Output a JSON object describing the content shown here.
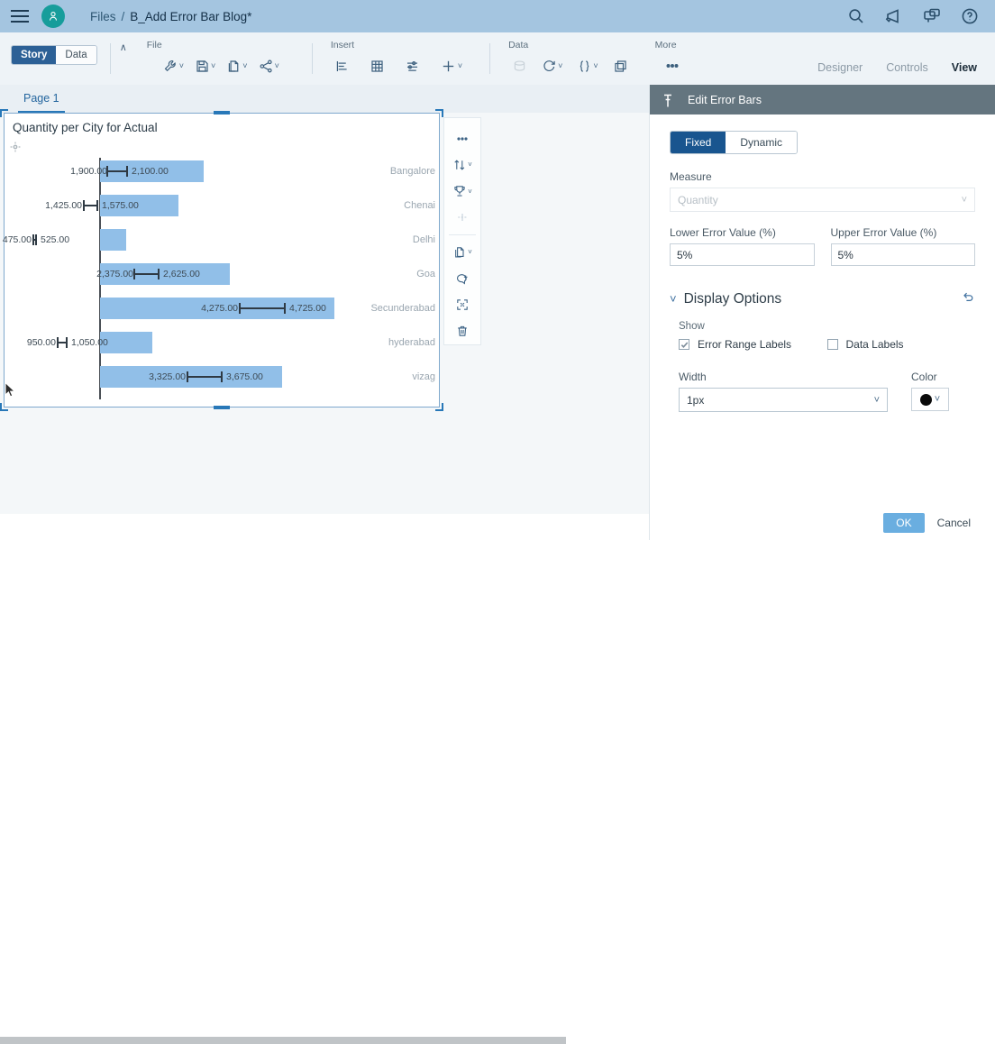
{
  "header": {
    "menu_icon": "hamburger-icon",
    "avatar_icon": "user-avatar-icon",
    "breadcrumb_root": "Files",
    "breadcrumb_sep": "/",
    "breadcrumb_current": "B_Add Error Bar Blog*",
    "actions": [
      {
        "name": "search-icon",
        "label": "Search"
      },
      {
        "name": "announcement-icon",
        "label": "Announcements"
      },
      {
        "name": "collaboration-icon",
        "label": "Collaboration"
      },
      {
        "name": "help-icon",
        "label": "Help"
      }
    ]
  },
  "ribbon": {
    "mode_story": "Story",
    "mode_data": "Data",
    "collapse_caret": "∧",
    "groups": [
      {
        "title": "File",
        "items": [
          {
            "name": "tools-icon",
            "caret": true,
            "disabled": false
          },
          {
            "name": "save-icon",
            "caret": true,
            "disabled": false
          },
          {
            "name": "copy-file-icon",
            "caret": true,
            "disabled": false
          },
          {
            "name": "share-icon",
            "caret": true,
            "disabled": false
          }
        ]
      },
      {
        "title": "Insert",
        "items": [
          {
            "name": "chart-icon",
            "caret": false,
            "disabled": false
          },
          {
            "name": "table-icon",
            "caret": false,
            "disabled": false
          },
          {
            "name": "filter-settings-icon",
            "caret": false,
            "disabled": false
          },
          {
            "name": "add-icon",
            "caret": true,
            "disabled": false
          }
        ]
      },
      {
        "title": "Data",
        "items": [
          {
            "name": "data-source-icon",
            "caret": false,
            "disabled": true
          },
          {
            "name": "refresh-icon",
            "caret": true,
            "disabled": false
          },
          {
            "name": "formula-icon",
            "caret": true,
            "disabled": false
          },
          {
            "name": "duplicate-icon",
            "caret": false,
            "disabled": false
          }
        ]
      },
      {
        "title": "More",
        "items": [
          {
            "name": "overflow-icon",
            "caret": false,
            "disabled": false
          }
        ]
      }
    ],
    "right_menu": [
      {
        "label": "Designer",
        "active": false
      },
      {
        "label": "Controls",
        "active": false
      },
      {
        "label": "View",
        "active": true
      }
    ]
  },
  "tabs": {
    "page_tab": "Page 1"
  },
  "widget_toolbar": [
    {
      "name": "more-options-icon",
      "caret": false,
      "disabled": false
    },
    {
      "name": "sort-icon",
      "caret": true,
      "disabled": false
    },
    {
      "name": "ranking-icon",
      "caret": true,
      "disabled": false
    },
    {
      "name": "reference-line-icon",
      "caret": false,
      "disabled": true
    },
    {
      "name": "copy-icon",
      "caret": true,
      "disabled": false
    },
    {
      "name": "add-comment-icon",
      "caret": false,
      "disabled": false
    },
    {
      "name": "fullscreen-icon",
      "caret": false,
      "disabled": false
    },
    {
      "name": "delete-icon",
      "caret": false,
      "disabled": false
    }
  ],
  "chart_data": {
    "type": "bar",
    "title": "Quantity per City for Actual",
    "orientation": "horizontal",
    "xlabel": "",
    "ylabel": "",
    "categories": [
      "Bangalore",
      "Chenai",
      "Delhi",
      "Goa",
      "Secunderabad",
      "hyderabad",
      "vizag"
    ],
    "values": [
      2000,
      1500,
      500,
      2500,
      4500,
      1000,
      3500
    ],
    "lower_error_values": [
      1900,
      1425,
      475,
      2375,
      4275,
      950,
      3325
    ],
    "upper_error_values": [
      2100,
      1575,
      525,
      2625,
      4725,
      1050,
      3675
    ],
    "lower_error_labels": [
      "1,900.00",
      "1,425.00",
      "475.00",
      "2,375.00",
      "4,275.00",
      "950.00",
      "3,325.00"
    ],
    "upper_error_labels": [
      "2,100.00",
      "1,575.00",
      "525.00",
      "2,625.00",
      "4,725.00",
      "1,050.00",
      "3,675.00"
    ],
    "xlim": [
      0,
      5000
    ],
    "grid": false,
    "legend": "none",
    "bar_color": "#91bfe8",
    "error_color": "#2f3a44"
  },
  "panel": {
    "title": "Edit Error Bars",
    "pin_icon": "pin-icon",
    "mode_fixed": "Fixed",
    "mode_dynamic": "Dynamic",
    "measure_label": "Measure",
    "measure_value": "Quantity",
    "lower_label": "Lower Error Value (%)",
    "lower_value": "5%",
    "upper_label": "Upper Error Value (%)",
    "upper_value": "5%",
    "display_options_title": "Display Options",
    "reset_icon": "reset-icon",
    "show_label": "Show",
    "check_error_range": "Error Range Labels",
    "check_data_labels": "Data Labels",
    "width_label": "Width",
    "width_value": "1px",
    "color_label": "Color",
    "color_value": "#0a0a0a",
    "ok_label": "OK",
    "cancel_label": "Cancel"
  }
}
